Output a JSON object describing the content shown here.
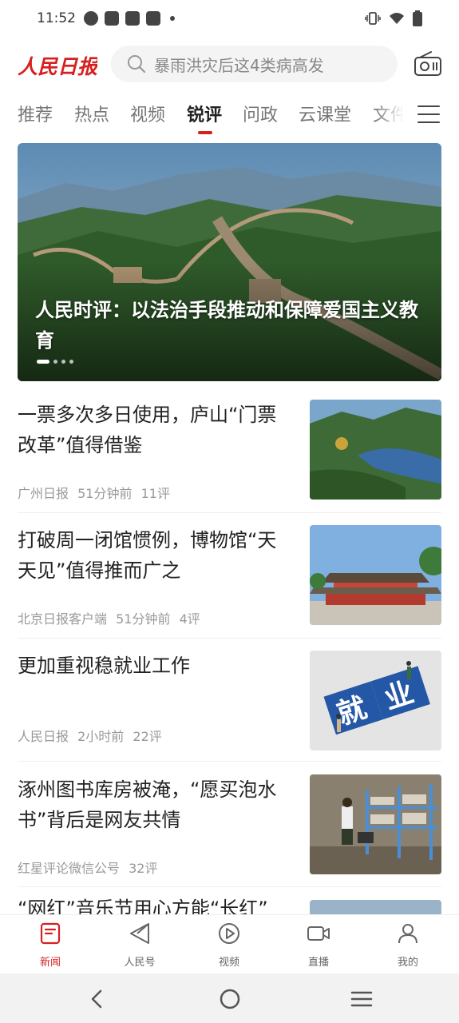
{
  "status_bar": {
    "time": "11:52",
    "left_icons": [
      "circle-status-icon",
      "bag-icon",
      "bag-icon",
      "bag-icon"
    ],
    "right_icons": [
      "vibrate-icon",
      "wifi-icon",
      "battery-icon"
    ]
  },
  "header": {
    "logo_text": "人民日报",
    "search_placeholder": "暴雨洪灾后这4类病高发",
    "radio_icon": "radio-icon"
  },
  "tabs": [
    {
      "label": "推荐"
    },
    {
      "label": "热点"
    },
    {
      "label": "视频"
    },
    {
      "label": "锐评",
      "active": true
    },
    {
      "label": "问政"
    },
    {
      "label": "云课堂"
    },
    {
      "label": "文件"
    }
  ],
  "hero": {
    "caption": "人民时评：以法治手段推动和保障爱国主义教育",
    "slides": 4,
    "current_slide": 1
  },
  "news": [
    {
      "title": "一票多次多日使用，庐山“门票改革”值得借鉴",
      "source": "广州日报",
      "time": "51分钟前",
      "comments": "11评"
    },
    {
      "title": "打破周一闭馆惯例，博物馆“天天见”值得推而广之",
      "source": "北京日报客户端",
      "time": "51分钟前",
      "comments": "4评"
    },
    {
      "title": "更加重视稳就业工作",
      "source": "人民日报",
      "time": "2小时前",
      "comments": "22评",
      "thumb_text": [
        "就",
        "业"
      ]
    },
    {
      "title": "涿州图书库房被淹，“愿买泡水书”背后是网友共情",
      "source": "红星评论微信公号",
      "time": "",
      "comments": "32评"
    },
    {
      "title": "“网红”音乐节用心方能“长红”"
    }
  ],
  "bottom_nav": [
    {
      "label": "新闻",
      "icon": "news-icon",
      "active": true
    },
    {
      "label": "人民号",
      "icon": "paper-plane-icon"
    },
    {
      "label": "视频",
      "icon": "play-icon"
    },
    {
      "label": "直播",
      "icon": "camera-icon"
    },
    {
      "label": "我的",
      "icon": "person-icon"
    }
  ],
  "system_nav": [
    "back-icon",
    "home-icon",
    "recents-icon"
  ],
  "colors": {
    "brand_red": "#d71f1f",
    "text_primary": "#222222",
    "text_meta": "#999999"
  }
}
